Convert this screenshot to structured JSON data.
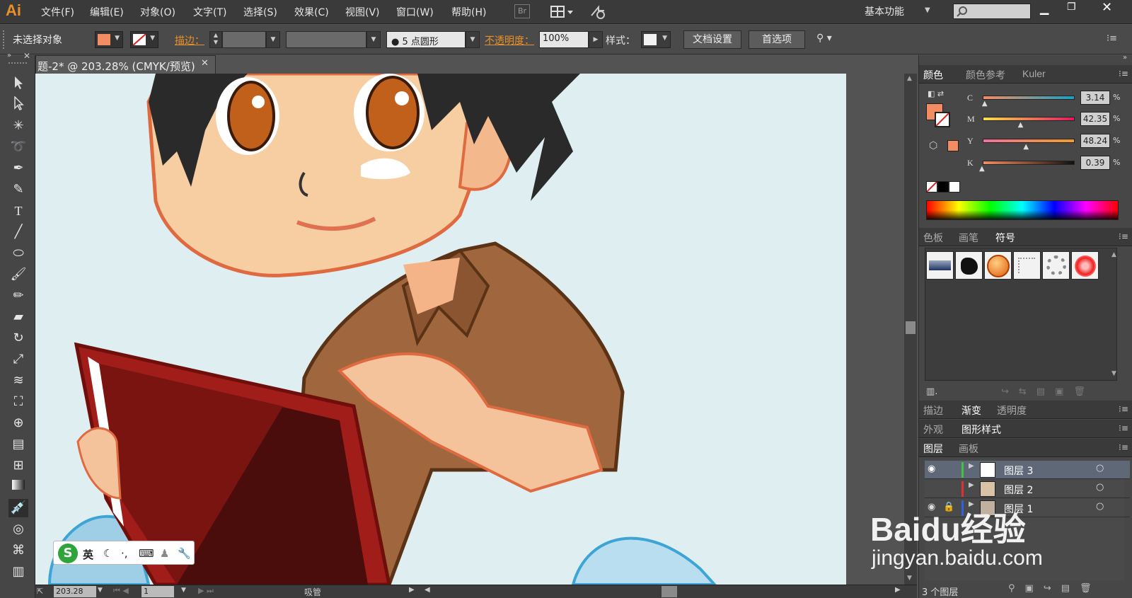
{
  "app": {
    "logo": "Ai"
  },
  "menu": [
    "文件(F)",
    "编辑(E)",
    "对象(O)",
    "文字(T)",
    "选择(S)",
    "效果(C)",
    "视图(V)",
    "窗口(W)",
    "帮助(H)"
  ],
  "bridge_label": "Br",
  "workspace": {
    "label": "基本功能"
  },
  "control": {
    "selection": "未选择对象",
    "stroke_label": "描边：",
    "brush_value": "5 点圆形",
    "opacity_label": "不透明度：",
    "opacity_value": "100%",
    "style_label": "样式：",
    "doc_setup": "文档设置",
    "preferences": "首选项"
  },
  "document_tab": {
    "title": "题-2* @ 203.28% (CMYK/预览)"
  },
  "status": {
    "zoom": "203.28",
    "artboard": "1",
    "tool": "吸管"
  },
  "color_panel": {
    "tabs": [
      "颜色",
      "颜色参考",
      "Kuler"
    ],
    "channels": [
      {
        "label": "C",
        "value": "3.14",
        "fraction": 0.03
      },
      {
        "label": "M",
        "value": "42.35",
        "fraction": 0.42
      },
      {
        "label": "Y",
        "value": "48.24",
        "fraction": 0.48
      },
      {
        "label": "K",
        "value": "0.39",
        "fraction": 0.0
      }
    ],
    "percent": "%",
    "fill_color": "#f28c62"
  },
  "symbol_panel": {
    "tabs": [
      "色板",
      "画笔",
      "符号"
    ]
  },
  "gradient_panel": {
    "tabs": [
      "描边",
      "渐变",
      "透明度"
    ]
  },
  "appearance_panel": {
    "tabs": [
      "外观",
      "图形样式"
    ]
  },
  "layers_panel": {
    "tabs": [
      "图层",
      "画板"
    ],
    "layers": [
      "图层 3",
      "图层 2",
      "图层 1"
    ],
    "count": "3 个图层"
  },
  "ime": {
    "lang": "英"
  },
  "watermark": {
    "line1": "Baidu经验",
    "line2": "jingyan.baidu.com"
  },
  "colors": {
    "accent": "#e8902a",
    "selected_layer": "#5f6877",
    "canvas_bg": "#dfeef0"
  }
}
